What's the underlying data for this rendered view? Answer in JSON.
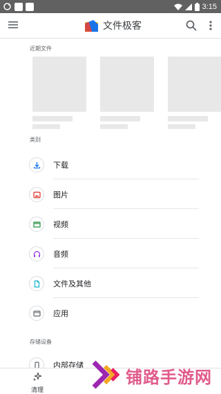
{
  "status_bar": {
    "time": "3:15"
  },
  "app_bar": {
    "title": "文件极客"
  },
  "recent": {
    "label": "近期文件"
  },
  "categories": {
    "label": "类别",
    "items": [
      {
        "label": "下载",
        "icon": "download-icon",
        "color": "#1a73e8"
      },
      {
        "label": "图片",
        "icon": "image-icon",
        "color": "#d93025"
      },
      {
        "label": "视频",
        "icon": "video-icon",
        "color": "#1e8e3e"
      },
      {
        "label": "音频",
        "icon": "headphones-icon",
        "color": "#9334e6"
      },
      {
        "label": "文件及其他",
        "icon": "document-icon",
        "color": "#12b5cb"
      },
      {
        "label": "应用",
        "icon": "app-icon",
        "color": "#5f6368"
      }
    ]
  },
  "storage": {
    "label": "存储设备",
    "items": [
      {
        "label": "内部存储",
        "icon": "phone-storage-icon"
      }
    ]
  },
  "bottom_nav": {
    "clean_label": "清理"
  },
  "watermark": {
    "text": "铺路手游网"
  }
}
